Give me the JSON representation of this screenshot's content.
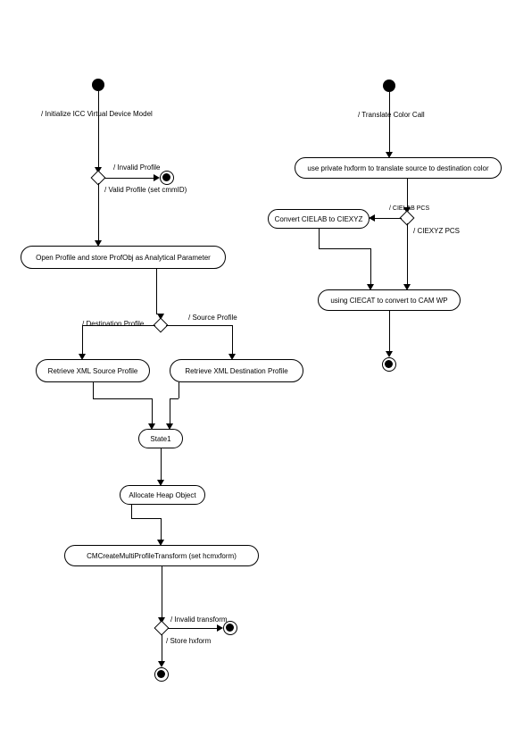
{
  "left": {
    "labels": {
      "init": "/ Initialize ICC Virtual Device Model",
      "invalidProfile": "/ Invalid Profile",
      "validProfile": "/ Valid Profile (set cmmID)",
      "openProfile": "Open Profile and store ProfObj as Analytical Parameter",
      "destProfile": "/ Destination Profile",
      "sourceProfile": "/ Source Profile",
      "retrieveSrc": "Retrieve XML Source Profile",
      "retrieveDest": "Retrieve XML Destination Profile",
      "state1": "State1",
      "allocHeap": "Allocate Heap Object",
      "cmCreate": "CMCreateMultiProfileTransform (set hcmxform)",
      "invalidTransform": "/ Invalid transform",
      "storeHxform": "/ Store hxform"
    }
  },
  "right": {
    "labels": {
      "translateCall": "/ Translate Color Call",
      "usePrivate": "use private hxform to translate source to destination color",
      "cielabPcs": "/ CIELAB PCS",
      "ciexyzPcs": "/ CIEXYZ PCS",
      "convertLab": "Convert CIELAB to CIEXYZ",
      "usingCiecat": "using CIECAT to convert to CAM WP"
    }
  }
}
